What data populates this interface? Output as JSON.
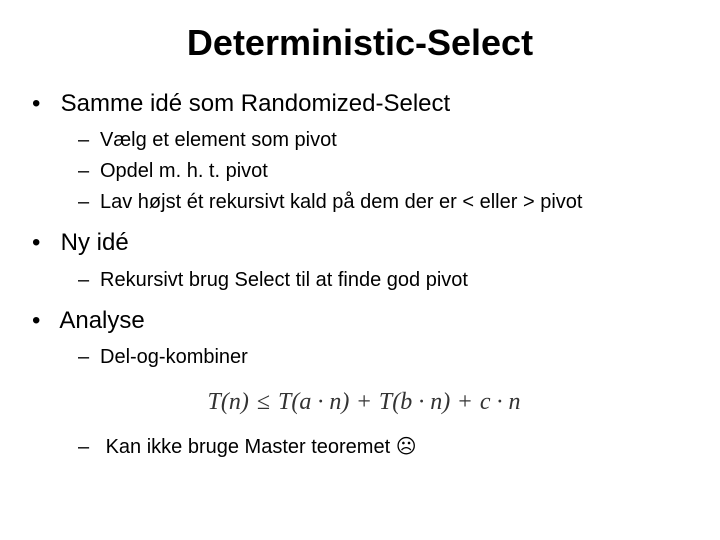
{
  "title": "Deterministic-Select",
  "b1": {
    "text": "Samme idé som Randomized-Select",
    "subs": [
      "Vælg et element som pivot",
      "Opdel m. h. t. pivot",
      "Lav højst ét rekursivt kald på dem der er < eller > pivot"
    ]
  },
  "b2": {
    "text": "Ny idé",
    "subs": [
      "Rekursivt brug Select til at finde god pivot"
    ]
  },
  "b3": {
    "text": "Analyse",
    "subs_a": "Del-og-kombiner",
    "subs_b": "Kan ikke bruge Master teoremet ",
    "frown": "☹"
  },
  "formula": {
    "lhs": "T(n)",
    "le": "≤",
    "t1": "T(a · n)",
    "plus1": "+",
    "t2": "T(b · n)",
    "plus2": "+",
    "t3": "c · n"
  }
}
